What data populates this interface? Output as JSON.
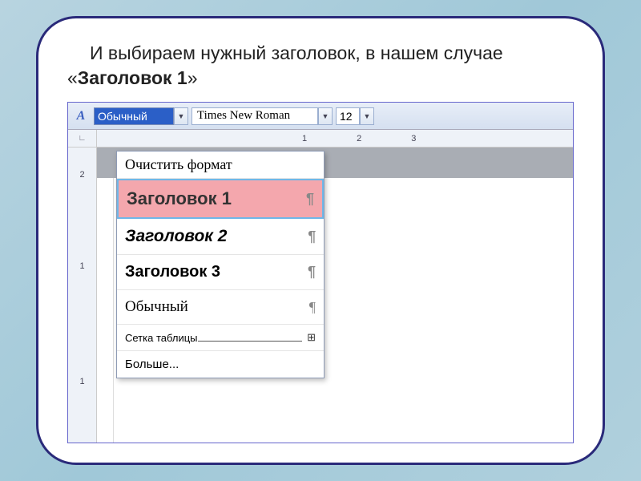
{
  "instruction": {
    "prefix": "И выбираем нужный заголовок, в нашем случае «",
    "bold": "Заголовок 1",
    "suffix": "»"
  },
  "toolbar": {
    "style_value": "Обычный",
    "font_value": "Times New Roman",
    "size_value": "12"
  },
  "ruler": {
    "h": [
      "1",
      "2",
      "3"
    ],
    "v": [
      "2",
      "1",
      "1"
    ]
  },
  "dropdown": {
    "clear": "Очистить формат",
    "h1": "Заголовок 1",
    "h2": "Заголовок 2",
    "h3": "Заголовок 3",
    "normal": "Обычный",
    "grid": "Сетка таблицы",
    "more": "Больше..."
  },
  "glyphs": {
    "pilcrow": "¶",
    "grid": "⊞",
    "chevron_down": "▼",
    "corner": "∟"
  }
}
